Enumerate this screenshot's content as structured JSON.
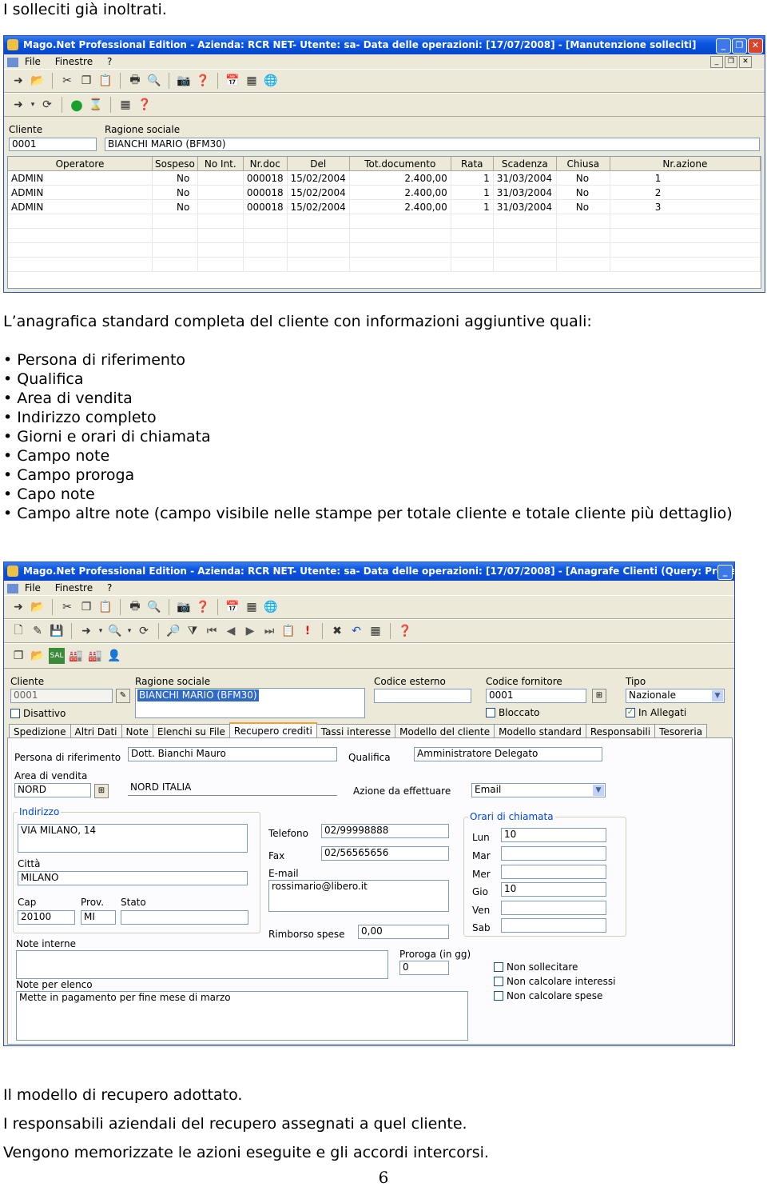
{
  "doc": {
    "intro": "I solleciti già inoltrati.",
    "section2": "L’anagrafica standard completa del cliente con informazioni aggiuntive quali:",
    "bullets": [
      "• Persona di riferimento",
      "• Qualifica",
      "• Area di vendita",
      "• Indirizzo completo",
      "• Giorni e orari di chiamata",
      "• Campo note",
      "• Campo proroga",
      "• Capo note",
      "• Campo altre note (campo visibile nelle stampe per totale cliente e totale cliente più dettaglio)"
    ],
    "footer_lines": [
      "Il modello di recupero adottato.",
      "I responsabili aziendali del recupero assegnati a quel cliente.",
      "Vengono memorizzate le azioni eseguite e gli accordi intercorsi."
    ],
    "page_number": "6"
  },
  "win1": {
    "title": "Mago.Net Professional Edition - Azienda: RCR NET- Utente: sa- Data delle operazioni: [17/07/2008] - [Manutenzione solleciti]",
    "menu": [
      "File",
      "Finestre",
      "?"
    ],
    "cliente_label": "Cliente",
    "cliente_value": "0001",
    "ragione_label": "Ragione sociale",
    "ragione_value": "BIANCHI MARIO (BFM30)",
    "columns": [
      "Operatore",
      "Sospeso",
      "No Int.",
      "Nr.doc",
      "Del",
      "Tot.documento",
      "Rata",
      "Scadenza",
      "Chiusa",
      "Nr.azione"
    ],
    "rows": [
      [
        "ADMIN",
        "No",
        "",
        "000018",
        "15/02/2004",
        "2.400,00",
        "1",
        "31/03/2004",
        "No",
        "1"
      ],
      [
        "ADMIN",
        "No",
        "",
        "000018",
        "15/02/2004",
        "2.400,00",
        "1",
        "31/03/2004",
        "No",
        "2"
      ],
      [
        "ADMIN",
        "No",
        "",
        "000018",
        "15/02/2004",
        "2.400,00",
        "1",
        "31/03/2004",
        "No",
        "3"
      ]
    ]
  },
  "win2": {
    "title": "Mago.Net Professional Edition - Azienda: RCR NET- Utente: sa- Data delle operazioni: [17/07/2008] - [Anagrafe Clienti (Query: Predefinita)]",
    "menu": [
      "File",
      "Finestre",
      "?"
    ],
    "header": {
      "cliente_label": "Cliente",
      "cliente_value": "0001",
      "disattivo": "Disattivo",
      "ragione_label": "Ragione sociale",
      "ragione_value": "BIANCHI MARIO (BFM30)",
      "codice_esterno_label": "Codice esterno",
      "codice_fornitore_label": "Codice fornitore",
      "codice_fornitore_value": "0001",
      "bloccato": "Bloccato",
      "tipo_label": "Tipo",
      "tipo_value": "Nazionale",
      "in_allegati": "In Allegati"
    },
    "tabs": [
      "Spedizione",
      "Altri Dati",
      "Note",
      "Elenchi su File",
      "Recupero crediti",
      "Tassi interesse",
      "Modello del cliente",
      "Modello standard",
      "Responsabili",
      "Tesoreria"
    ],
    "form": {
      "persona_label": "Persona di riferimento",
      "persona_value": "Dott. Bianchi Mauro",
      "qualifica_label": "Qualifica",
      "qualifica_value": "Amministratore Delegato",
      "area_label": "Area di vendita",
      "area_code": "NORD",
      "area_desc": "NORD ITALIA",
      "azione_label": "Azione da effettuare",
      "azione_value": "Email",
      "indirizzo_title": "Indirizzo",
      "indirizzo_value": "VIA MILANO, 14",
      "citta_label": "Città",
      "citta_value": "MILANO",
      "cap_label": "Cap",
      "cap_value": "20100",
      "prov_label": "Prov.",
      "prov_value": "MI",
      "stato_label": "Stato",
      "telefono_label": "Telefono",
      "telefono_value": "02/99998888",
      "fax_label": "Fax",
      "fax_value": "02/56565656",
      "email_label": "E-mail",
      "email_value": "rossimario@libero.it",
      "rimborso_label": "Rimborso spese",
      "rimborso_value": "0,00",
      "orari_title": "Orari di chiamata",
      "days": [
        {
          "label": "Lun",
          "value": "10"
        },
        {
          "label": "Mar",
          "value": ""
        },
        {
          "label": "Mer",
          "value": ""
        },
        {
          "label": "Gio",
          "value": "10"
        },
        {
          "label": "Ven",
          "value": ""
        },
        {
          "label": "Sab",
          "value": ""
        }
      ],
      "note_interne_label": "Note interne",
      "proroga_label": "Proroga (in gg)",
      "proroga_value": "0",
      "check_non_sollecitare": "Non sollecitare",
      "check_non_interessi": "Non calcolare interessi",
      "check_non_spese": "Non calcolare spese",
      "note_elenco_label": "Note per elenco",
      "note_elenco_value": "Mette in pagamento per fine mese di marzo"
    }
  }
}
